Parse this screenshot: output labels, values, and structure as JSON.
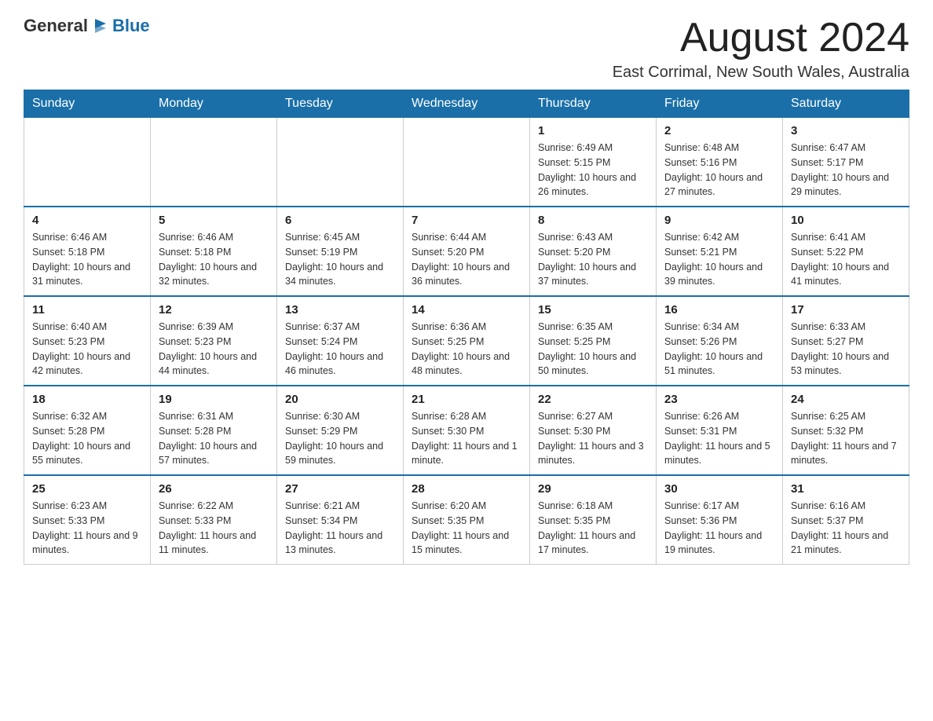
{
  "logo": {
    "text_general": "General",
    "text_blue": "Blue"
  },
  "header": {
    "month_title": "August 2024",
    "location": "East Corrimal, New South Wales, Australia"
  },
  "days_of_week": [
    "Sunday",
    "Monday",
    "Tuesday",
    "Wednesday",
    "Thursday",
    "Friday",
    "Saturday"
  ],
  "weeks": [
    [
      {
        "day": "",
        "info": ""
      },
      {
        "day": "",
        "info": ""
      },
      {
        "day": "",
        "info": ""
      },
      {
        "day": "",
        "info": ""
      },
      {
        "day": "1",
        "info": "Sunrise: 6:49 AM\nSunset: 5:15 PM\nDaylight: 10 hours and 26 minutes."
      },
      {
        "day": "2",
        "info": "Sunrise: 6:48 AM\nSunset: 5:16 PM\nDaylight: 10 hours and 27 minutes."
      },
      {
        "day": "3",
        "info": "Sunrise: 6:47 AM\nSunset: 5:17 PM\nDaylight: 10 hours and 29 minutes."
      }
    ],
    [
      {
        "day": "4",
        "info": "Sunrise: 6:46 AM\nSunset: 5:18 PM\nDaylight: 10 hours and 31 minutes."
      },
      {
        "day": "5",
        "info": "Sunrise: 6:46 AM\nSunset: 5:18 PM\nDaylight: 10 hours and 32 minutes."
      },
      {
        "day": "6",
        "info": "Sunrise: 6:45 AM\nSunset: 5:19 PM\nDaylight: 10 hours and 34 minutes."
      },
      {
        "day": "7",
        "info": "Sunrise: 6:44 AM\nSunset: 5:20 PM\nDaylight: 10 hours and 36 minutes."
      },
      {
        "day": "8",
        "info": "Sunrise: 6:43 AM\nSunset: 5:20 PM\nDaylight: 10 hours and 37 minutes."
      },
      {
        "day": "9",
        "info": "Sunrise: 6:42 AM\nSunset: 5:21 PM\nDaylight: 10 hours and 39 minutes."
      },
      {
        "day": "10",
        "info": "Sunrise: 6:41 AM\nSunset: 5:22 PM\nDaylight: 10 hours and 41 minutes."
      }
    ],
    [
      {
        "day": "11",
        "info": "Sunrise: 6:40 AM\nSunset: 5:23 PM\nDaylight: 10 hours and 42 minutes."
      },
      {
        "day": "12",
        "info": "Sunrise: 6:39 AM\nSunset: 5:23 PM\nDaylight: 10 hours and 44 minutes."
      },
      {
        "day": "13",
        "info": "Sunrise: 6:37 AM\nSunset: 5:24 PM\nDaylight: 10 hours and 46 minutes."
      },
      {
        "day": "14",
        "info": "Sunrise: 6:36 AM\nSunset: 5:25 PM\nDaylight: 10 hours and 48 minutes."
      },
      {
        "day": "15",
        "info": "Sunrise: 6:35 AM\nSunset: 5:25 PM\nDaylight: 10 hours and 50 minutes."
      },
      {
        "day": "16",
        "info": "Sunrise: 6:34 AM\nSunset: 5:26 PM\nDaylight: 10 hours and 51 minutes."
      },
      {
        "day": "17",
        "info": "Sunrise: 6:33 AM\nSunset: 5:27 PM\nDaylight: 10 hours and 53 minutes."
      }
    ],
    [
      {
        "day": "18",
        "info": "Sunrise: 6:32 AM\nSunset: 5:28 PM\nDaylight: 10 hours and 55 minutes."
      },
      {
        "day": "19",
        "info": "Sunrise: 6:31 AM\nSunset: 5:28 PM\nDaylight: 10 hours and 57 minutes."
      },
      {
        "day": "20",
        "info": "Sunrise: 6:30 AM\nSunset: 5:29 PM\nDaylight: 10 hours and 59 minutes."
      },
      {
        "day": "21",
        "info": "Sunrise: 6:28 AM\nSunset: 5:30 PM\nDaylight: 11 hours and 1 minute."
      },
      {
        "day": "22",
        "info": "Sunrise: 6:27 AM\nSunset: 5:30 PM\nDaylight: 11 hours and 3 minutes."
      },
      {
        "day": "23",
        "info": "Sunrise: 6:26 AM\nSunset: 5:31 PM\nDaylight: 11 hours and 5 minutes."
      },
      {
        "day": "24",
        "info": "Sunrise: 6:25 AM\nSunset: 5:32 PM\nDaylight: 11 hours and 7 minutes."
      }
    ],
    [
      {
        "day": "25",
        "info": "Sunrise: 6:23 AM\nSunset: 5:33 PM\nDaylight: 11 hours and 9 minutes."
      },
      {
        "day": "26",
        "info": "Sunrise: 6:22 AM\nSunset: 5:33 PM\nDaylight: 11 hours and 11 minutes."
      },
      {
        "day": "27",
        "info": "Sunrise: 6:21 AM\nSunset: 5:34 PM\nDaylight: 11 hours and 13 minutes."
      },
      {
        "day": "28",
        "info": "Sunrise: 6:20 AM\nSunset: 5:35 PM\nDaylight: 11 hours and 15 minutes."
      },
      {
        "day": "29",
        "info": "Sunrise: 6:18 AM\nSunset: 5:35 PM\nDaylight: 11 hours and 17 minutes."
      },
      {
        "day": "30",
        "info": "Sunrise: 6:17 AM\nSunset: 5:36 PM\nDaylight: 11 hours and 19 minutes."
      },
      {
        "day": "31",
        "info": "Sunrise: 6:16 AM\nSunset: 5:37 PM\nDaylight: 11 hours and 21 minutes."
      }
    ]
  ]
}
